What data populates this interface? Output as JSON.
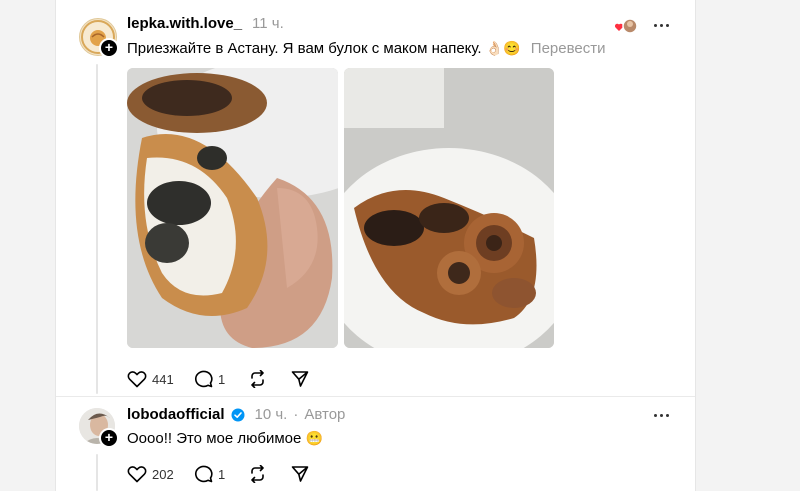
{
  "post1": {
    "username": "lepka.with.love_",
    "time": "11 ч.",
    "text": "Приезжайте в Астану. Я вам булок с маком напеку.",
    "emojis": "👌🏻😊",
    "translate": "Перевести",
    "likes": "441",
    "replies": "1",
    "avatar_text": "LEPKA"
  },
  "post2": {
    "username": "lobodaofficial",
    "time": "10 ч.",
    "separator": "·",
    "author_badge": "Автор",
    "text": "Оооо!! Это мое любимое",
    "emoji": "😬",
    "likes": "202",
    "replies": "1"
  },
  "colors": {
    "verified": "#0095f6",
    "meta_gray": "#999999",
    "divider": "#eaeaea"
  }
}
